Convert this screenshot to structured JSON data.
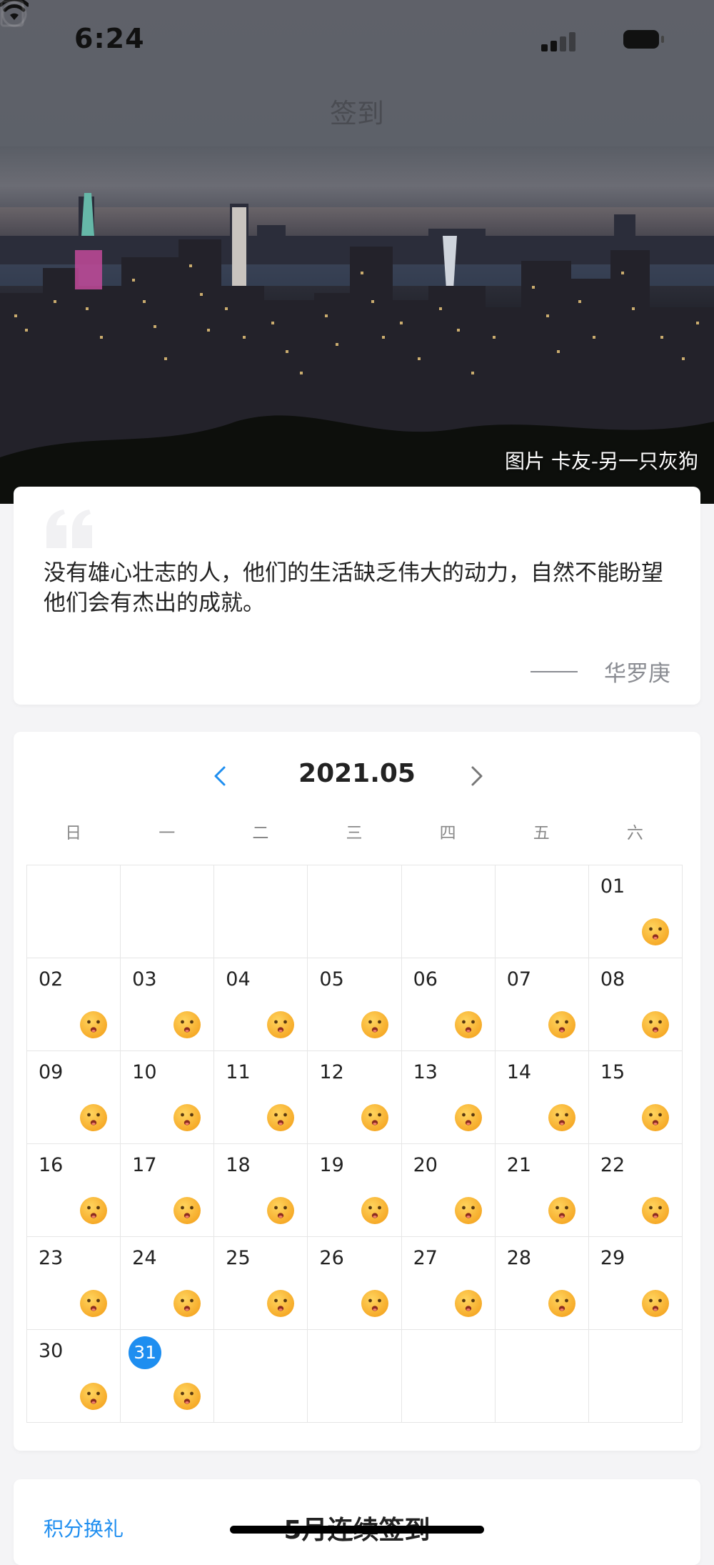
{
  "status_bar": {
    "time": "6:24"
  },
  "nav": {
    "title": "签到"
  },
  "hero": {
    "photo_credit": "图片 卡友-另一只灰狗"
  },
  "quote": {
    "text": "没有雄心壮志的人，他们的生活缺乏伟大的动力，自然不能盼望他们会有杰出的成就。",
    "author": "华罗庚"
  },
  "calendar": {
    "month_label": "2021.05",
    "weekdays": [
      "日",
      "一",
      "二",
      "三",
      "四",
      "五",
      "六"
    ],
    "leading_blank_days": 6,
    "days": [
      {
        "label": "01",
        "checked_in": true
      },
      {
        "label": "02",
        "checked_in": true
      },
      {
        "label": "03",
        "checked_in": true
      },
      {
        "label": "04",
        "checked_in": true
      },
      {
        "label": "05",
        "checked_in": true
      },
      {
        "label": "06",
        "checked_in": true
      },
      {
        "label": "07",
        "checked_in": true
      },
      {
        "label": "08",
        "checked_in": true
      },
      {
        "label": "09",
        "checked_in": true
      },
      {
        "label": "10",
        "checked_in": true
      },
      {
        "label": "11",
        "checked_in": true
      },
      {
        "label": "12",
        "checked_in": true
      },
      {
        "label": "13",
        "checked_in": true
      },
      {
        "label": "14",
        "checked_in": true
      },
      {
        "label": "15",
        "checked_in": true
      },
      {
        "label": "16",
        "checked_in": true
      },
      {
        "label": "17",
        "checked_in": true
      },
      {
        "label": "18",
        "checked_in": true
      },
      {
        "label": "19",
        "checked_in": true
      },
      {
        "label": "20",
        "checked_in": true
      },
      {
        "label": "21",
        "checked_in": true
      },
      {
        "label": "22",
        "checked_in": true
      },
      {
        "label": "23",
        "checked_in": true
      },
      {
        "label": "24",
        "checked_in": true
      },
      {
        "label": "25",
        "checked_in": true
      },
      {
        "label": "26",
        "checked_in": true
      },
      {
        "label": "27",
        "checked_in": true
      },
      {
        "label": "28",
        "checked_in": true
      },
      {
        "label": "29",
        "checked_in": true
      },
      {
        "label": "30",
        "checked_in": true
      },
      {
        "label": "31",
        "checked_in": true,
        "today": true
      }
    ],
    "trailing_blank_days": 5,
    "today_color": "#1e8ef0",
    "checkin_icon": "smiley-face-icon"
  },
  "bottom": {
    "redeem_link": "积分换礼",
    "streak_title": "5月连续签到"
  },
  "colors": {
    "accent": "#1e8ef0",
    "background": "#f4f4f6"
  }
}
